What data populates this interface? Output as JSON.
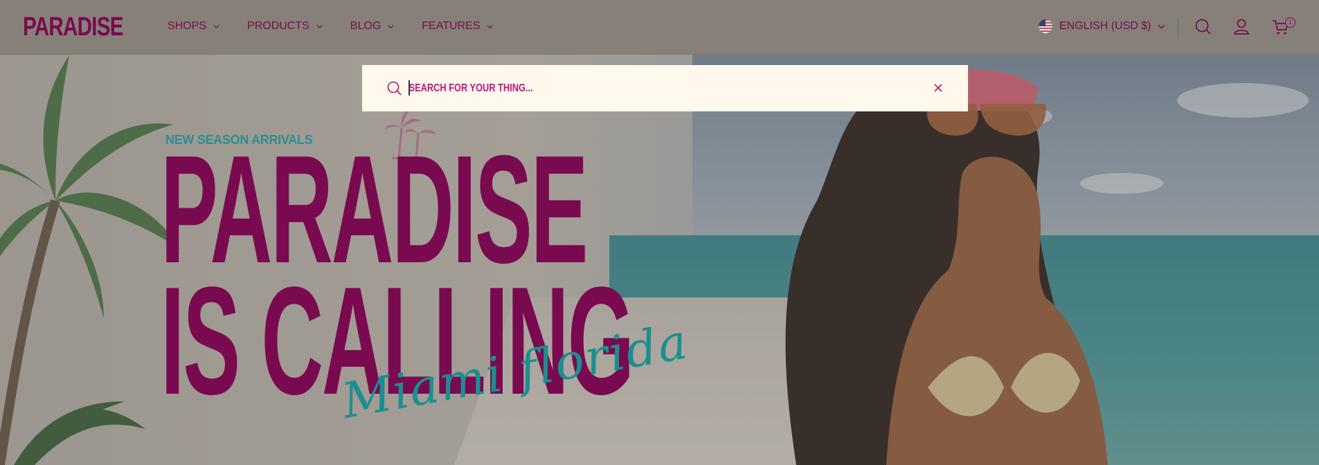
{
  "header": {
    "logo": "PARADISE",
    "nav": [
      {
        "label": "SHOPS"
      },
      {
        "label": "PRODUCTS"
      },
      {
        "label": "BLOG"
      },
      {
        "label": "FEATURES"
      }
    ],
    "language": "ENGLISH (USD $)",
    "cart_count": "1"
  },
  "search": {
    "placeholder": "SEARCH FOR YOUR THING...",
    "value": ""
  },
  "hero": {
    "eyebrow": "NEW SEASON ARRIVALS",
    "headline_line1": "PARADISE",
    "headline_line2": "IS CALLING",
    "script": "Miami florida"
  },
  "colors": {
    "brand": "#7a0a4f",
    "accent_teal": "#2a8f8f",
    "search_bg": "#fff8ed",
    "search_text": "#c0177c"
  },
  "icons": [
    "search-icon",
    "user-icon",
    "cart-icon",
    "close-icon",
    "chevron-down-icon",
    "us-flag-icon"
  ]
}
